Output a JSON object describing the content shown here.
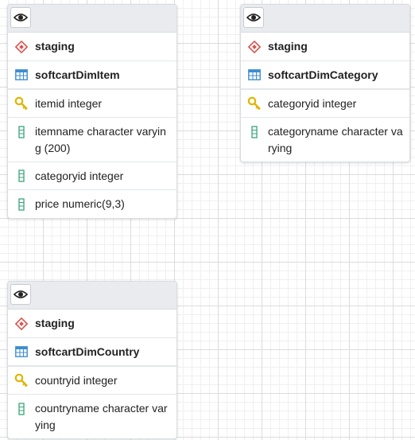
{
  "nodes": [
    {
      "schema": "staging",
      "table": "softcartDimItem",
      "columns": [
        {
          "key": "pk",
          "text": "itemid integer"
        },
        {
          "key": "col",
          "text": "itemname character varying (200)"
        },
        {
          "key": "col",
          "text": "categoryid integer"
        },
        {
          "key": "col",
          "text": "price numeric(9,3)"
        }
      ]
    },
    {
      "schema": "staging",
      "table": "softcartDimCategory",
      "columns": [
        {
          "key": "pk",
          "text": "categoryid integer"
        },
        {
          "key": "col",
          "text": "categoryname character varying"
        }
      ]
    },
    {
      "schema": "staging",
      "table": "softcartDimCountry",
      "columns": [
        {
          "key": "pk",
          "text": "countryid integer"
        },
        {
          "key": "col",
          "text": "countryname character varying"
        }
      ]
    }
  ],
  "colors": {
    "schema_icon": "#d9534f",
    "table_icon": "#3c8dd1",
    "key_icon": "#e0b400",
    "column_icon": "#3aa57a"
  }
}
